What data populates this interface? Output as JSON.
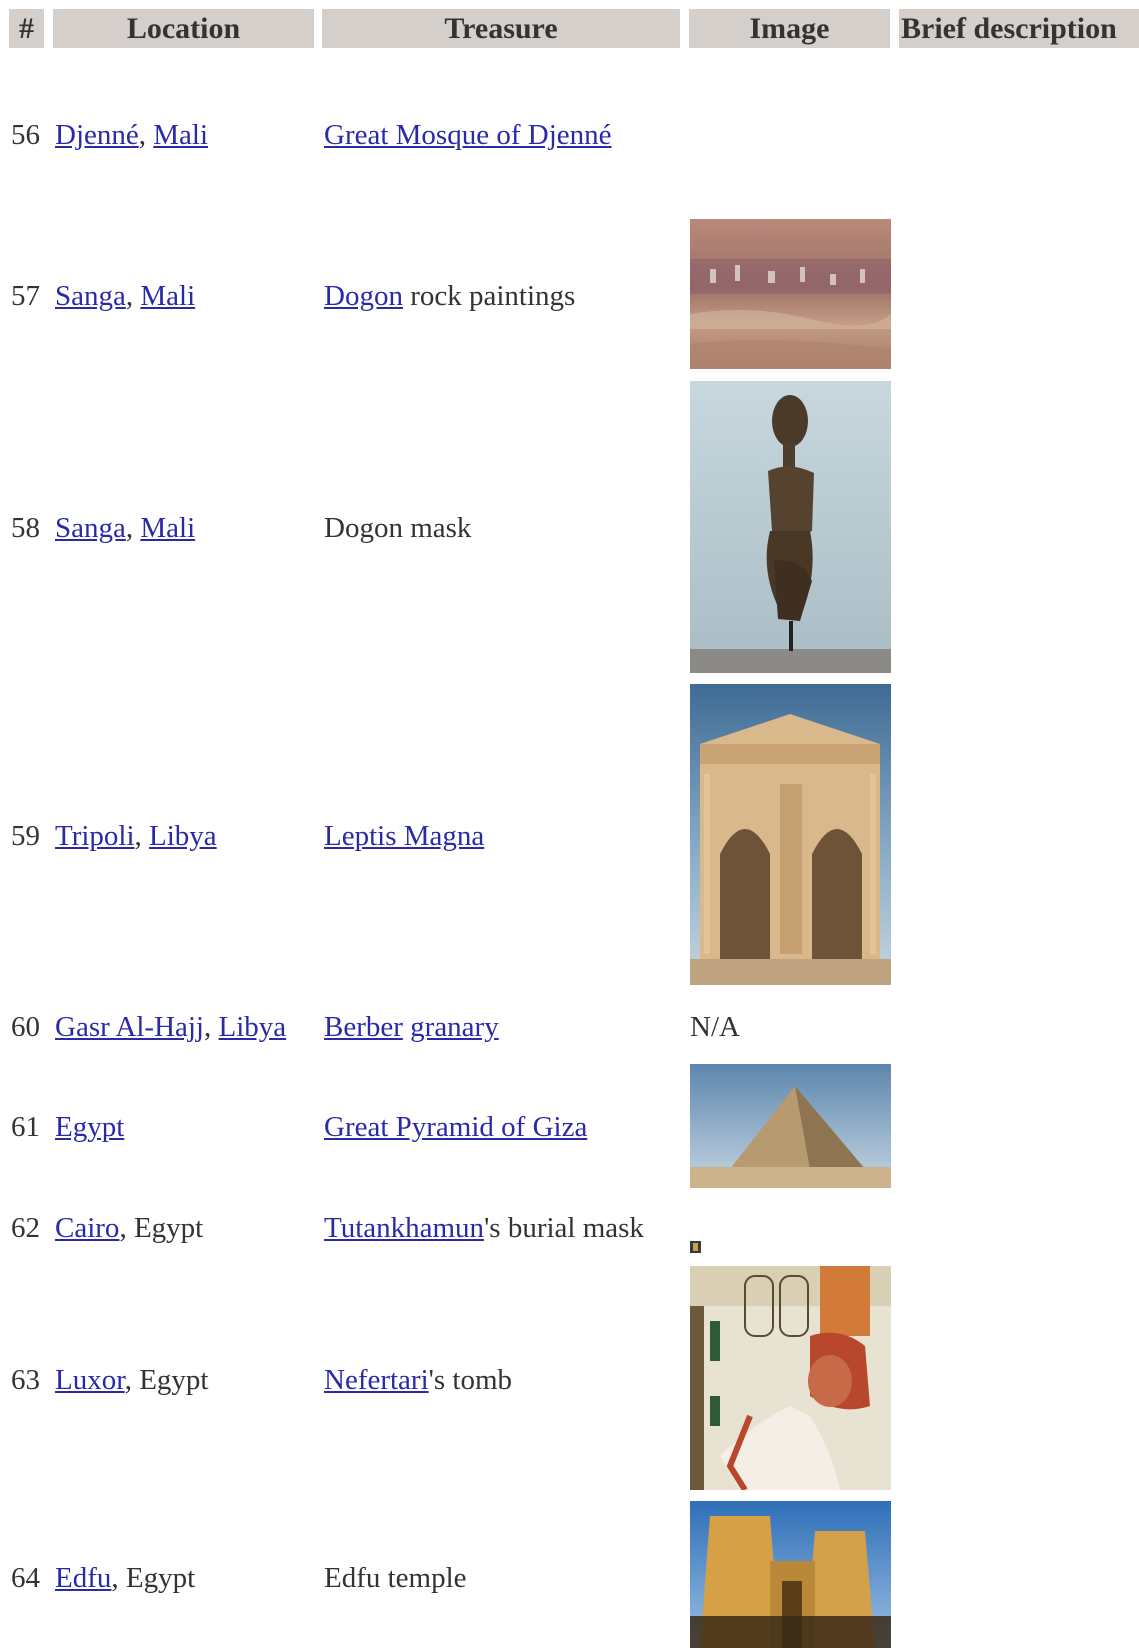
{
  "headers": {
    "num": "#",
    "location": "Location",
    "treasure": "Treasure",
    "image": "Image",
    "description": "Brief description"
  },
  "rows": [
    {
      "num": "56",
      "loc_a": "Djenné",
      "loc_sep": ", ",
      "loc_b": "Mali",
      "tre_link": "Great Mosque of Djenné",
      "tre_rest": "",
      "image": "none"
    },
    {
      "num": "57",
      "loc_a": "Sanga",
      "loc_sep": ", ",
      "loc_b": "Mali",
      "tre_link": "Dogon",
      "tre_rest": " rock paintings",
      "image": "rock-paintings-photo"
    },
    {
      "num": "58",
      "loc_a": "Sanga",
      "loc_sep": ", ",
      "loc_b": "Mali",
      "tre_link": "",
      "tre_rest": "Dogon mask",
      "image": "dogon-statue-photo"
    },
    {
      "num": "59",
      "loc_a": "Tripoli",
      "loc_sep": ", ",
      "loc_b": "Libya",
      "tre_link": "Leptis Magna",
      "tre_rest": "",
      "image": "roman-arch-photo"
    },
    {
      "num": "60",
      "loc_a": "Gasr Al-Hajj",
      "loc_sep": ", ",
      "loc_b": "Libya",
      "tre_link": "Berber",
      "tre_link2": "granary",
      "tre_rest": "",
      "image_text": "N/A"
    },
    {
      "num": "61",
      "loc_a": "Egypt",
      "loc_sep": "",
      "loc_b": "",
      "tre_link": "Great Pyramid of Giza",
      "tre_rest": "",
      "image": "pyramid-photo"
    },
    {
      "num": "62",
      "loc_a": "Cairo",
      "loc_sep": ", Egypt",
      "loc_b": "",
      "tre_link": "Tutankhamun",
      "tre_rest": "'s burial mask",
      "image": "tiny-mask-thumbnail"
    },
    {
      "num": "63",
      "loc_a": "Luxor",
      "loc_sep": ", Egypt",
      "loc_b": "",
      "tre_link": "Nefertari",
      "tre_rest": "'s tomb",
      "image": "tomb-painting-photo"
    },
    {
      "num": "64",
      "loc_a": "Edfu",
      "loc_sep": ", Egypt",
      "loc_b": "",
      "tre_link": "",
      "tre_rest": "Edfu temple",
      "image": "temple-photo"
    }
  ]
}
